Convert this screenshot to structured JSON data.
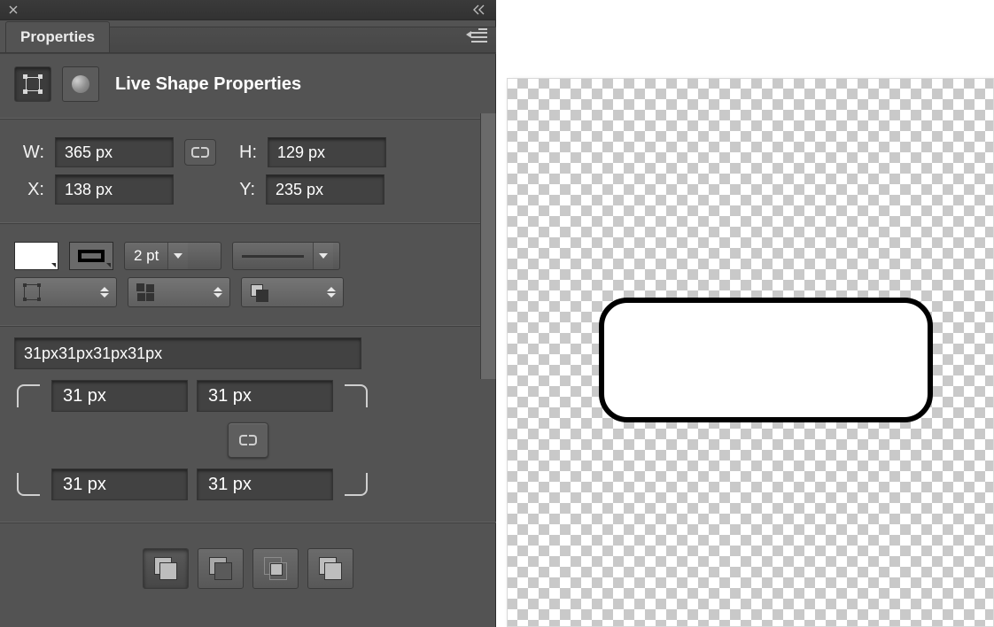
{
  "panel": {
    "tab_label": "Properties",
    "header_title": "Live Shape Properties"
  },
  "dims": {
    "w_label": "W:",
    "w_value": "365 px",
    "h_label": "H:",
    "h_value": "129 px",
    "x_label": "X:",
    "x_value": "138 px",
    "y_label": "Y:",
    "y_value": "235 px"
  },
  "stroke": {
    "weight": "2 pt"
  },
  "corners": {
    "summary": "31px31px31px31px",
    "tl": "31 px",
    "tr": "31 px",
    "bl": "31 px",
    "br": "31 px"
  },
  "shape": {
    "left_px": "104",
    "top_px": "248",
    "width_px": "365",
    "height_px": "129"
  }
}
